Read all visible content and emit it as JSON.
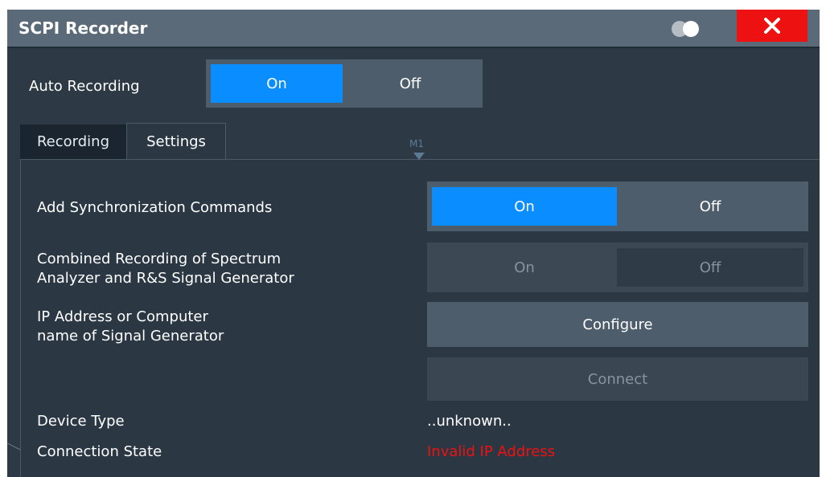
{
  "window": {
    "title": "SCPI Recorder"
  },
  "auto_recording": {
    "label": "Auto Recording",
    "on_label": "On",
    "off_label": "Off",
    "selected": "On"
  },
  "tabs": [
    {
      "label": "Recording"
    },
    {
      "label": "Settings",
      "active": true
    }
  ],
  "marker": {
    "label": "M1"
  },
  "settings": {
    "sync": {
      "label": "Add Synchronization Commands",
      "on_label": "On",
      "off_label": "Off",
      "selected": "On"
    },
    "combined": {
      "label_line1": "Combined Recording of Spectrum",
      "label_line2": "Analyzer and R&S Signal Generator",
      "on_label": "On",
      "off_label": "Off",
      "enabled": false
    },
    "ip": {
      "label_line1": "IP Address or Computer",
      "label_line2": "name of Signal Generator",
      "configure_label": "Configure",
      "connect_label": "Connect"
    },
    "device_type": {
      "label": "Device Type",
      "value": "..unknown.."
    },
    "connection_state": {
      "label": "Connection State",
      "value": "Invalid IP Address"
    }
  },
  "colors": {
    "accent": "#0a8eff",
    "close": "#ee1111",
    "error": "#ee1111",
    "dialog_bg": "#2d3a46"
  }
}
